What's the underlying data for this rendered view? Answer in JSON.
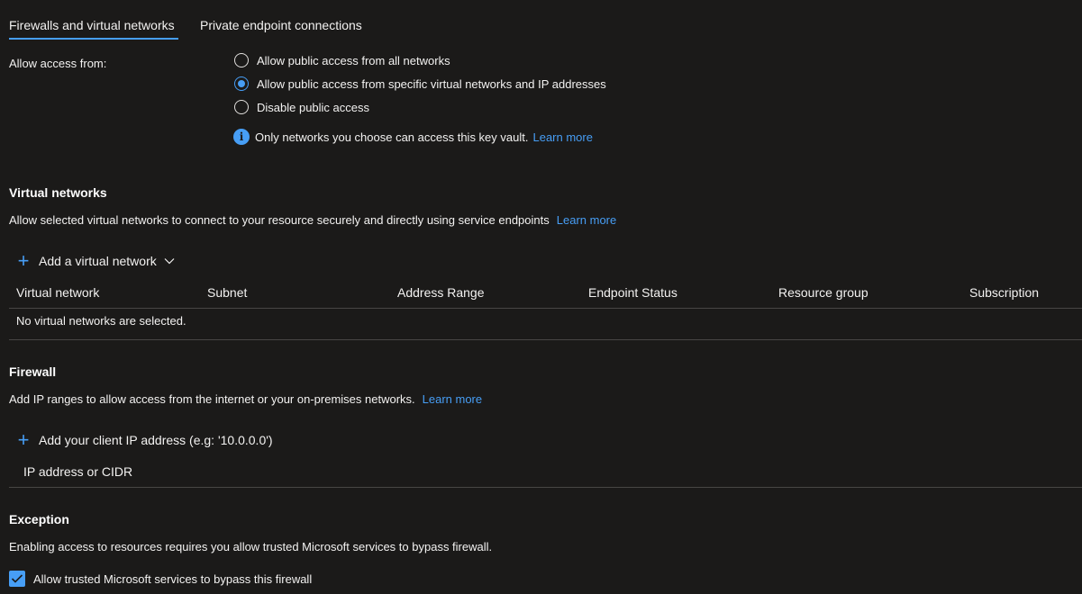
{
  "tabs": [
    {
      "label": "Firewalls and virtual networks",
      "active": true
    },
    {
      "label": "Private endpoint connections",
      "active": false
    }
  ],
  "access": {
    "label": "Allow access from:",
    "options": [
      {
        "label": "Allow public access from all networks",
        "checked": false
      },
      {
        "label": "Allow public access from specific virtual networks and IP addresses",
        "checked": true
      },
      {
        "label": "Disable public access",
        "checked": false
      }
    ],
    "info_text": "Only networks you choose can access this key vault.",
    "learn_more": "Learn more"
  },
  "vnets": {
    "title": "Virtual networks",
    "description": "Allow selected virtual networks to connect to your resource securely and directly using service endpoints",
    "learn_more": "Learn more",
    "add_label": "Add a virtual network",
    "columns": [
      "Virtual network",
      "Subnet",
      "Address Range",
      "Endpoint Status",
      "Resource group",
      "Subscription"
    ],
    "empty_text": "No virtual networks are selected."
  },
  "firewall": {
    "title": "Firewall",
    "description": "Add IP ranges to allow access from the internet or your on-premises networks.",
    "learn_more": "Learn more",
    "add_label": "Add your client IP address (e.g: '10.0.0.0')",
    "column": "IP address or CIDR"
  },
  "exception": {
    "title": "Exception",
    "description": "Enabling access to resources requires you allow trusted Microsoft services to bypass firewall.",
    "checkbox_label": "Allow trusted Microsoft services to bypass this firewall",
    "checked": true
  },
  "colors": {
    "accent": "#479ef5",
    "background": "#1b1a19",
    "text": "#ffffff",
    "divider": "#484644"
  }
}
